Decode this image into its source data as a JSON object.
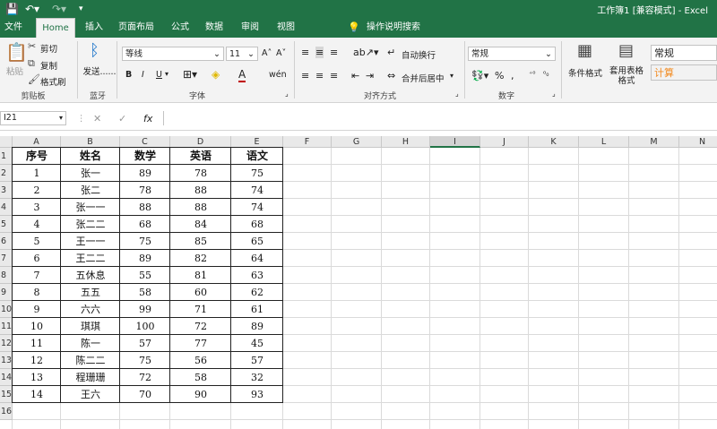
{
  "titlebar": {
    "save_icon": "save-icon",
    "undo_icon": "undo-icon",
    "redo_icon": "redo-icon",
    "title": "工作簿1 [兼容模式] - Excel"
  },
  "tabs": [
    "文件",
    "Home",
    "插入",
    "页面布局",
    "公式",
    "数据",
    "审阅",
    "视图"
  ],
  "tellme": "操作说明搜索",
  "ribbon": {
    "paste": "粘贴",
    "cut": "剪切",
    "copy": "复制",
    "format_painter": "格式刷",
    "clipboard_label": "剪贴板",
    "bluetooth_send": "发送......",
    "bluetooth_label": "蓝牙",
    "font_name": "等线",
    "font_size": "11",
    "bold": "B",
    "italic": "I",
    "underline": "U",
    "font_label": "字体",
    "wrap_text": "自动换行",
    "merge_center": "合并后居中",
    "align_label": "对齐方式",
    "number_format": "常规",
    "percent": "%",
    "comma": ",",
    "number_label": "数字",
    "conditional_format": "条件格式",
    "table_format": "套用表格格式",
    "style_normal": "常规",
    "style_calc": "计算"
  },
  "formula_bar": {
    "name_box": "I21",
    "fx": "fx",
    "content": ""
  },
  "columns": [
    "A",
    "B",
    "C",
    "D",
    "E",
    "F",
    "G",
    "H",
    "I",
    "J",
    "K",
    "L",
    "M",
    "N"
  ],
  "rows": [
    "1",
    "2",
    "3",
    "4",
    "5",
    "6",
    "7",
    "8",
    "9",
    "10",
    "11",
    "12",
    "13",
    "14",
    "15",
    "16"
  ],
  "table": {
    "headers": [
      "序号",
      "姓名",
      "数学",
      "英语",
      "语文"
    ],
    "rows": [
      [
        "1",
        "张一",
        "89",
        "78",
        "75"
      ],
      [
        "2",
        "张二",
        "78",
        "88",
        "74"
      ],
      [
        "3",
        "张一一",
        "88",
        "88",
        "74"
      ],
      [
        "4",
        "张二二",
        "68",
        "84",
        "68"
      ],
      [
        "5",
        "王一一",
        "75",
        "85",
        "65"
      ],
      [
        "6",
        "王二二",
        "89",
        "82",
        "64"
      ],
      [
        "7",
        "五休息",
        "55",
        "81",
        "63"
      ],
      [
        "8",
        "五五",
        "58",
        "60",
        "62"
      ],
      [
        "9",
        "六六",
        "99",
        "71",
        "61"
      ],
      [
        "10",
        "琪琪",
        "100",
        "72",
        "89"
      ],
      [
        "11",
        "陈一",
        "57",
        "77",
        "45"
      ],
      [
        "12",
        "陈二二",
        "75",
        "56",
        "57"
      ],
      [
        "13",
        "程珊珊",
        "72",
        "58",
        "32"
      ],
      [
        "14",
        "王六",
        "70",
        "90",
        "93"
      ]
    ]
  },
  "colors": {
    "accent": "#217346",
    "ribbon_bg": "#f3f3f3",
    "grid_line": "#dadada",
    "calc_orange": "#f28a1f"
  }
}
